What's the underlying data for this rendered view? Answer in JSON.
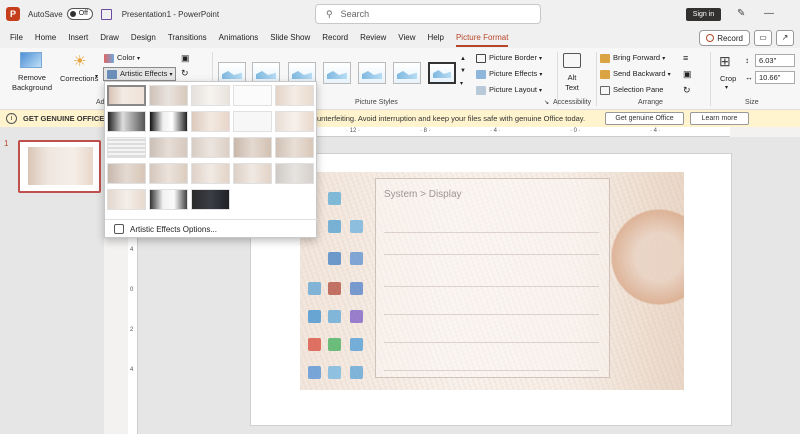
{
  "titlebar": {
    "autosave_label": "AutoSave",
    "autosave_state": "Off",
    "doc_title": "Presentation1 - PowerPoint",
    "search_placeholder": "Search",
    "signin_label": "Sign in"
  },
  "menu": {
    "tabs": [
      "File",
      "Home",
      "Insert",
      "Draw",
      "Design",
      "Transitions",
      "Animations",
      "Slide Show",
      "Record",
      "Review",
      "View",
      "Help",
      "Picture Format"
    ],
    "active_tab": "Picture Format",
    "record_label": "Record"
  },
  "ribbon": {
    "remove_background": "Remove Background",
    "corrections": "Corrections",
    "group_adjust_partial": "Ad",
    "color": "Color",
    "artistic_effects": "Artistic Effects",
    "picture_styles_label": "Picture Styles",
    "picture_border": "Picture Border",
    "picture_effects": "Picture Effects",
    "picture_layout": "Picture Layout",
    "alt_text": "Alt Text",
    "accessibility_label": "Accessibility",
    "bring_forward": "Bring Forward",
    "send_backward": "Send Backward",
    "selection_pane": "Selection Pane",
    "arrange_label": "Arrange",
    "crop": "Crop",
    "height_value": "6.03\"",
    "width_value": "10.66\"",
    "size_label": "Size"
  },
  "infobar": {
    "title": "GET GENUINE OFFICE",
    "message": "unterfeiting. Avoid interruption and keep your files safe with genuine Office today.",
    "get_genuine_btn": "Get genuine Office",
    "learn_more_btn": "Learn more"
  },
  "slides": {
    "number": "1"
  },
  "gallery": {
    "options_label": "Artistic Effects Options..."
  },
  "picture": {
    "window_title": "System  >  Display"
  },
  "colors": {
    "accent": "#b7472a",
    "info_bar": "#fff4ce",
    "selected_thumb_border": "#c0504d"
  }
}
